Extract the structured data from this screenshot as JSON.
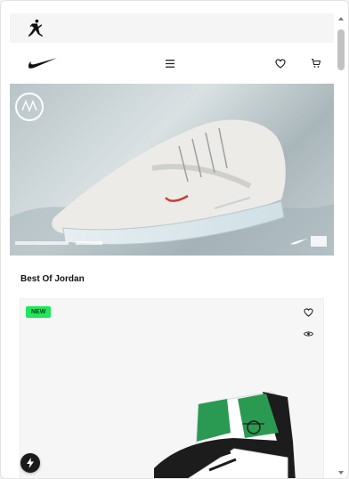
{
  "topbar": {
    "logo_icon": "jordan-jumpman-icon"
  },
  "navbar": {
    "logo_icon": "nike-swoosh-icon",
    "menu_icon": "hamburger-menu-icon",
    "wishlist_icon": "heart-icon",
    "cart_icon": "cart-icon"
  },
  "hero": {
    "image": "nike-air-max-pulse-sneaker"
  },
  "section": {
    "title": "Best Of Jordan"
  },
  "product_card": {
    "badge": "NEW",
    "wishlist_icon": "heart-icon",
    "quickview_icon": "eye-icon",
    "image": "air-jordan-1-green-white-black"
  },
  "fab": {
    "icon": "lightning-icon"
  },
  "colors": {
    "badge_bg": "#1ee85a",
    "swoosh_accent": "#c4432f",
    "jordan_green": "#2a9a52"
  }
}
